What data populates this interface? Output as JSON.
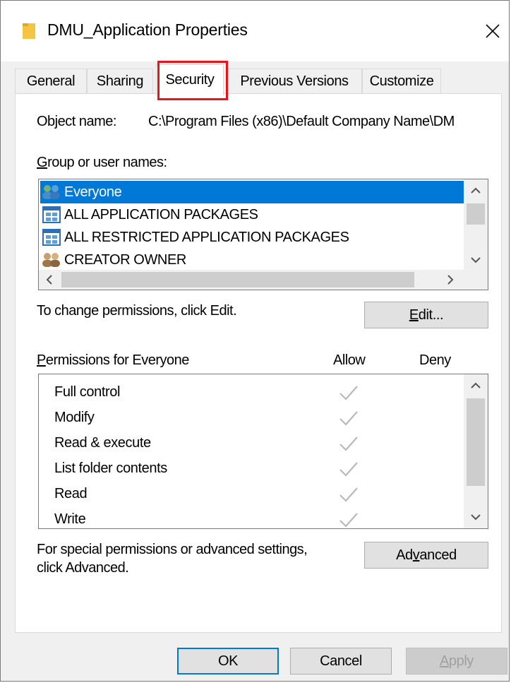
{
  "window": {
    "title": "DMU_Application Properties",
    "close_glyph": "✕"
  },
  "tabs": [
    {
      "label": "General"
    },
    {
      "label": "Sharing"
    },
    {
      "label": "Security",
      "active": true
    },
    {
      "label": "Previous Versions"
    },
    {
      "label": "Customize"
    }
  ],
  "security": {
    "object_name_label": "Object name:",
    "object_name_value": "C:\\Program Files (x86)\\Default Company Name\\DM",
    "group_label": "Group or user names:",
    "groups": [
      {
        "name": "Everyone",
        "icon": "users-icon",
        "selected": true
      },
      {
        "name": "ALL APPLICATION PACKAGES",
        "icon": "app-package-icon",
        "selected": false
      },
      {
        "name": "ALL RESTRICTED APPLICATION PACKAGES",
        "icon": "app-package-icon",
        "selected": false
      },
      {
        "name": "CREATOR OWNER",
        "icon": "users-icon",
        "selected": false
      }
    ],
    "change_hint": "To change permissions, click Edit.",
    "edit_label": "Edit...",
    "permissions_label": "Permissions for Everyone",
    "allow_header": "Allow",
    "deny_header": "Deny",
    "permissions": [
      {
        "name": "Full control",
        "allow": true,
        "deny": false
      },
      {
        "name": "Modify",
        "allow": true,
        "deny": false
      },
      {
        "name": "Read & execute",
        "allow": true,
        "deny": false
      },
      {
        "name": "List folder contents",
        "allow": true,
        "deny": false
      },
      {
        "name": "Read",
        "allow": true,
        "deny": false
      },
      {
        "name": "Write",
        "allow": true,
        "deny": false
      }
    ],
    "advanced_hint_line1": "For special permissions or advanced settings,",
    "advanced_hint_line2": "click Advanced.",
    "advanced_label": "Advanced"
  },
  "footer": {
    "ok_label": "OK",
    "cancel_label": "Cancel",
    "apply_label": "Apply"
  },
  "colors": {
    "accent": "#0078d7",
    "highlight": "#e8141b",
    "folder": "#f4c542",
    "check": "#b9b9b9"
  }
}
